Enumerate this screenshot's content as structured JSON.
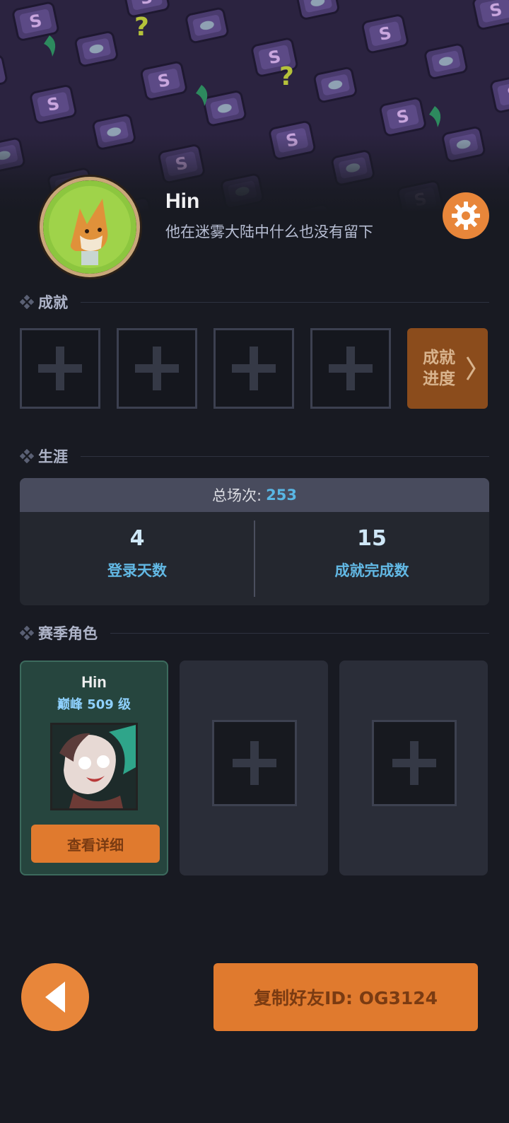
{
  "profile": {
    "name": "Hin",
    "signature": "他在迷雾大陆中什么也没有留下"
  },
  "sections": {
    "achievements": "成就",
    "career": "生涯",
    "season_characters": "赛季角色"
  },
  "achievements": {
    "progress_label_line1": "成就",
    "progress_label_line2": "进度"
  },
  "career": {
    "total_matches_label": "总场次:",
    "total_matches_value": "253",
    "stats": [
      {
        "value": "4",
        "label": "登录天数"
      },
      {
        "value": "15",
        "label": "成就完成数"
      }
    ]
  },
  "characters": [
    {
      "name": "Hin",
      "rank": "巅峰 509 级",
      "button": "查看详细"
    }
  ],
  "footer": {
    "copy_id_label": "复制好友ID: OG3124"
  },
  "colors": {
    "accent_orange": "#e8863a",
    "stat_blue": "#62b8e4",
    "background": "#181a22"
  }
}
